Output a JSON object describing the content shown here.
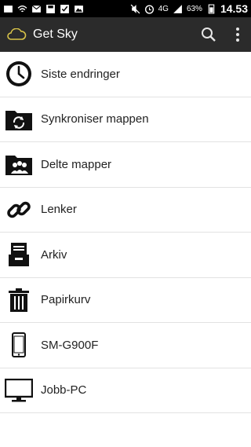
{
  "status_bar": {
    "network": "4G",
    "battery": "63%",
    "time": "14.53"
  },
  "app_bar": {
    "title": "Get Sky",
    "icons": [
      "cloud-icon",
      "search-icon",
      "overflow-menu-icon"
    ]
  },
  "menu": {
    "items": [
      {
        "label": "Siste endringer",
        "icon": "clock-icon"
      },
      {
        "label": "Synkroniser mappen",
        "icon": "sync-folder-icon"
      },
      {
        "label": "Delte mapper",
        "icon": "shared-folder-icon"
      },
      {
        "label": "Lenker",
        "icon": "link-icon"
      },
      {
        "label": "Arkiv",
        "icon": "archive-icon"
      },
      {
        "label": "Papirkurv",
        "icon": "trash-icon"
      },
      {
        "label": "SM-G900F",
        "icon": "phone-icon"
      },
      {
        "label": "Jobb-PC",
        "icon": "monitor-icon"
      }
    ]
  }
}
